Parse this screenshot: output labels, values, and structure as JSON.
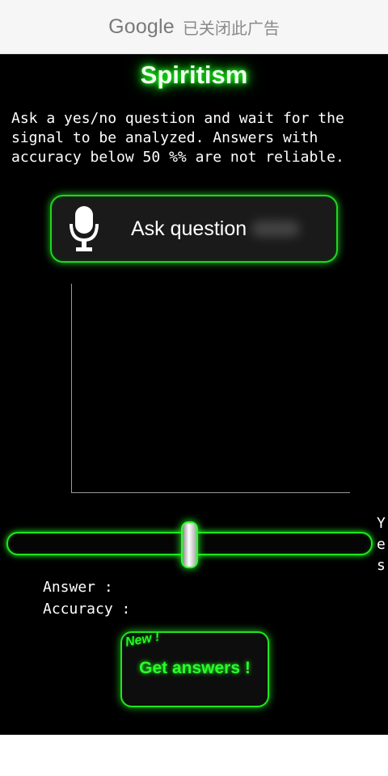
{
  "ad": {
    "brand": "Google",
    "status": "已关闭此广告"
  },
  "app": {
    "title": "Spiritism",
    "description": "Ask a yes/no question and wait for the signal to be analyzed. Answers with accuracy below 50 %% are not reliable.",
    "ask_button": {
      "label": "Ask question",
      "icon": "microphone-icon"
    },
    "slider": {
      "value_fraction": 0.5,
      "side_label_letters": [
        "Y",
        "e",
        "s"
      ]
    },
    "answer_label": "Answer :",
    "accuracy_label": "Accuracy :",
    "get_button": {
      "tag": "New !",
      "label": "Get answers !"
    }
  },
  "colors": {
    "accent": "#1eff1e",
    "background": "#000000"
  }
}
